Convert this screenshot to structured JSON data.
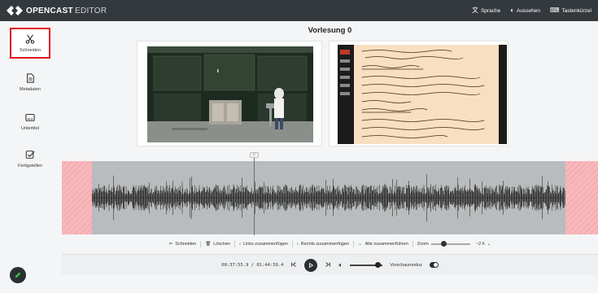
{
  "header": {
    "brand": "OPENCAST",
    "product": "EDITOR",
    "actions": [
      {
        "label": "Sprache",
        "icon": "language-icon"
      },
      {
        "label": "Aussehen",
        "icon": "theme-icon"
      },
      {
        "label": "Tastenkürzel",
        "icon": "keyboard-icon"
      }
    ]
  },
  "sidebar": {
    "items": [
      {
        "label": "Schneiden",
        "icon": "scissors-icon",
        "active": true
      },
      {
        "label": "Metadaten",
        "icon": "document-icon",
        "active": false
      },
      {
        "label": "Untertitel",
        "icon": "subtitles-icon",
        "active": false
      },
      {
        "label": "Fertigstellen",
        "icon": "checkbox-icon",
        "active": false
      }
    ]
  },
  "main": {
    "title": "Vorlesung 0"
  },
  "toolbar": {
    "cut_label": "Schneiden",
    "delete_label": "Löschen",
    "merge_left_label": "Links zusammenfügen",
    "merge_right_label": "Rechts zusammenfügen",
    "merge_all_label": "Alle zusammenführen",
    "zoom_label": "Zoom",
    "zoom_value": "~2 h",
    "zoom_level": 0.3
  },
  "player": {
    "timecode": "00:37:55.9 / 01:44:59.4",
    "volume": 0.85,
    "preview_label": "Vorschaumodus",
    "preview_on": true
  },
  "colors": {
    "header_bg": "#34393e",
    "active_border": "#e0141e",
    "cut_zone": "#f7b8bc",
    "waveform_bg": "#b9bbbd"
  }
}
